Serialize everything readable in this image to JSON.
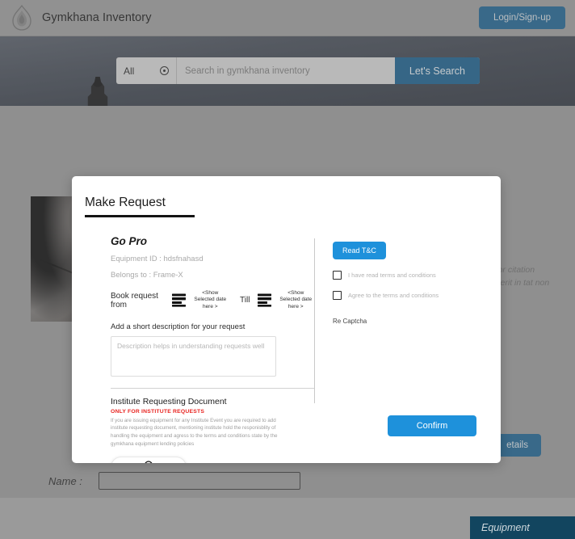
{
  "header": {
    "logo_icon": "flame-emblem-icon",
    "title": "Gymkhana Inventory",
    "login_label": "Login/Sign-up"
  },
  "search": {
    "category": "All",
    "category_icon": "target-circle-icon",
    "placeholder": "Search in gymkhana inventory",
    "value": "",
    "button_label": "Let's Search"
  },
  "background_page": {
    "detail_text": "mpor citation enderit in tat non",
    "details_button": "etails",
    "equipment_bar": "Equipment",
    "name_label": "Name :",
    "name_value": "",
    "photo_alt": "equipment-photo"
  },
  "modal": {
    "title": "Make Request",
    "equipment": {
      "name": "Go Pro",
      "equipment_id_line": "Equipment ID : hdsfnahasd",
      "belongs_to_line": "Belongs to : Frame-X"
    },
    "booking": {
      "from_label": "Book request from",
      "from_icon": "calendar-icon",
      "from_hint": "<Show Selected date here >",
      "till_label": "Till",
      "till_icon": "calendar-icon",
      "till_hint": "<Show Selected date here >"
    },
    "description": {
      "label": "Add a short description for your request",
      "placeholder": "Description helps in understanding requests well",
      "value": ""
    },
    "institute": {
      "title": "Institute Requesting Document",
      "warning": "ONLY FOR INSTITUTE REQUESTS",
      "body": "If you are issuing equipment for any Institute Event you are required to add institute requesting document, mentioning institute hold the responisblity of handling the equipment and agress to the terms and conditions state by the gymkhana equipment lending policies",
      "upload_icon": "cloud-upload-icon"
    },
    "terms": {
      "read_button": "Read T&C",
      "checkbox_1": "I have read terms and conditions",
      "checkbox_2": "Agree to the terms and conditions",
      "captcha_label": "Re Captcha"
    },
    "confirm_label": "Confirm"
  },
  "colors": {
    "accent_blue": "#1e91db",
    "dark_blue": "#1f6391",
    "warning_red": "#e8231f"
  }
}
